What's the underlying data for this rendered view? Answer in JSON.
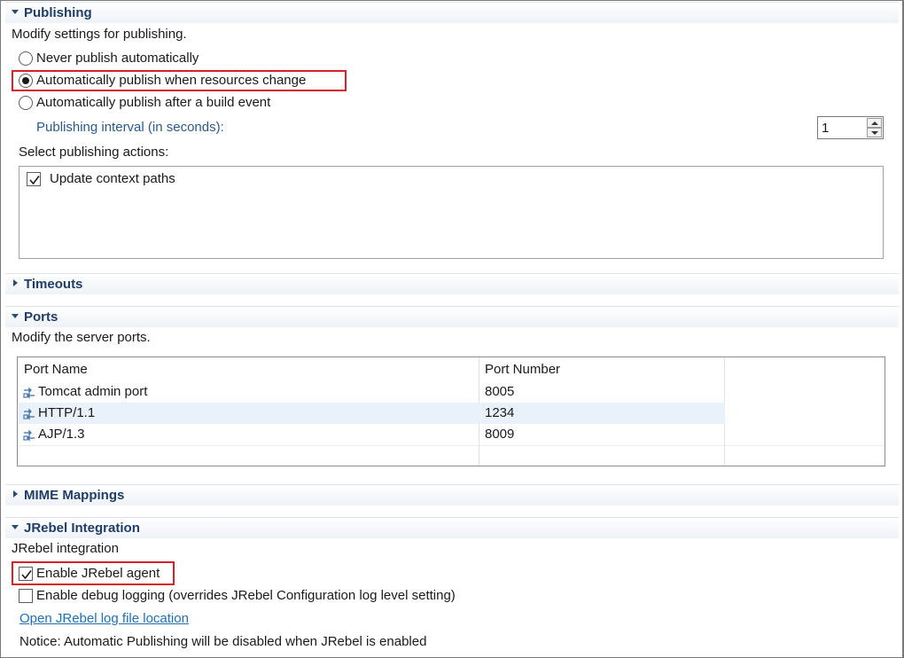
{
  "publishing": {
    "title": "Publishing",
    "description": "Modify settings for publishing.",
    "options": [
      {
        "label": "Never publish automatically",
        "selected": false
      },
      {
        "label": "Automatically publish when resources change",
        "selected": true
      },
      {
        "label": "Automatically publish after a build event",
        "selected": false
      }
    ],
    "interval_label": "Publishing interval (in seconds):",
    "interval_value": "1",
    "actions_label": "Select publishing actions:",
    "actions": [
      {
        "label": "Update context paths",
        "checked": true
      }
    ]
  },
  "timeouts": {
    "title": "Timeouts"
  },
  "ports": {
    "title": "Ports",
    "description": "Modify the server ports.",
    "columns": [
      "Port Name",
      "Port Number"
    ],
    "rows": [
      {
        "name": "Tomcat admin port",
        "number": "8005"
      },
      {
        "name": "HTTP/1.1",
        "number": "1234"
      },
      {
        "name": "AJP/1.3",
        "number": "8009"
      }
    ]
  },
  "mime": {
    "title": "MIME Mappings"
  },
  "jrebel": {
    "title": "JRebel Integration",
    "subtitle": "JRebel integration",
    "enable_agent_label": "Enable JRebel agent",
    "enable_agent_checked": true,
    "debug_logging_label": "Enable debug logging (overrides JRebel Configuration log level setting)",
    "debug_logging_checked": false,
    "log_link": "Open JRebel log file location",
    "notice": "Notice: Automatic Publishing will be disabled when JRebel is enabled"
  },
  "colors": {
    "section_title": "#1f3d66",
    "highlight_box": "#d8202a",
    "link": "#1f6fb5",
    "selected_row": "#e9f1fb"
  },
  "icons": {
    "section_open": "triangle-down",
    "section_closed": "triangle-right",
    "port_icon": "port-connector-icon",
    "checkbox_mark": "check-mark"
  }
}
